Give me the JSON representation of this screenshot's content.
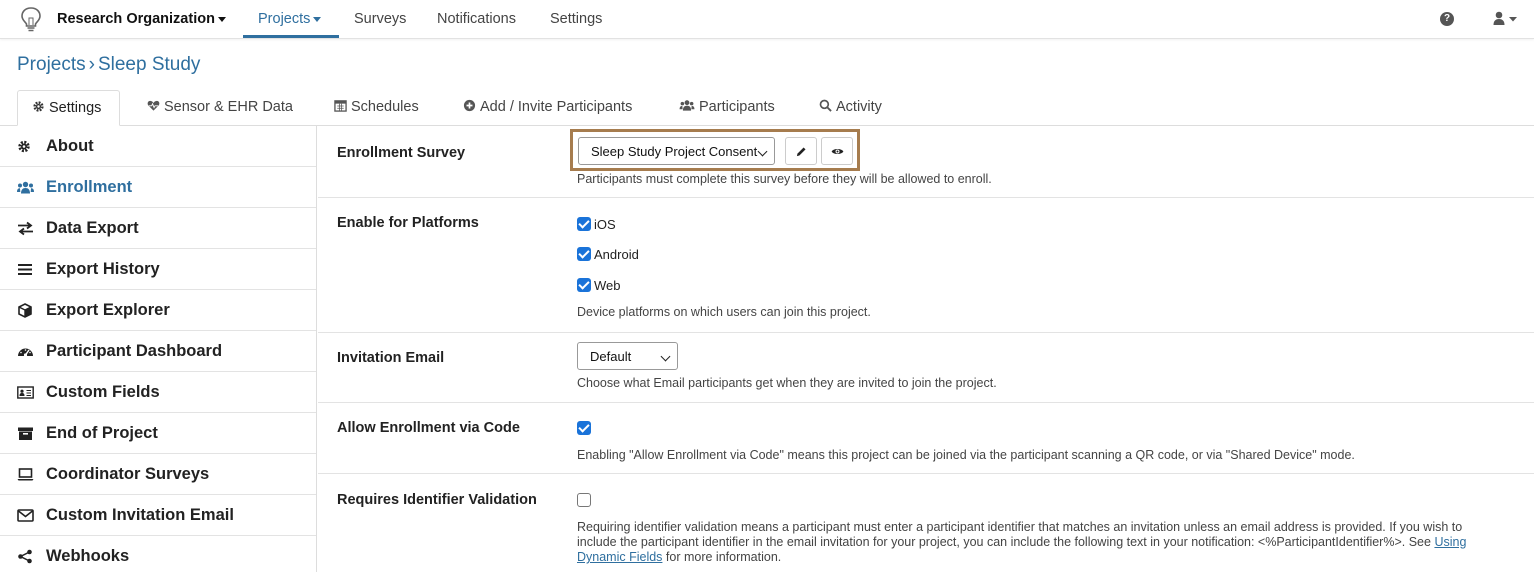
{
  "topnav": {
    "org": "Research Organization",
    "items": [
      "Projects",
      "Surveys",
      "Notifications",
      "Settings"
    ],
    "active": "Projects"
  },
  "breadcrumb": {
    "parent": "Projects",
    "current": "Sleep Study"
  },
  "tabs": [
    {
      "label": "Settings",
      "icon": "gear-icon"
    },
    {
      "label": "Sensor & EHR Data",
      "icon": "heartbeat-icon"
    },
    {
      "label": "Schedules",
      "icon": "calendar-icon"
    },
    {
      "label": "Add / Invite Participants",
      "icon": "plus-circle-icon"
    },
    {
      "label": "Participants",
      "icon": "users-icon"
    },
    {
      "label": "Activity",
      "icon": "search-icon"
    }
  ],
  "sidebar": {
    "items": [
      {
        "label": "About",
        "icon": "gear-icon"
      },
      {
        "label": "Enrollment",
        "icon": "users-icon"
      },
      {
        "label": "Data Export",
        "icon": "exchange-icon"
      },
      {
        "label": "Export History",
        "icon": "list-icon"
      },
      {
        "label": "Export Explorer",
        "icon": "cube-icon"
      },
      {
        "label": "Participant Dashboard",
        "icon": "dashboard-icon"
      },
      {
        "label": "Custom Fields",
        "icon": "id-card-icon"
      },
      {
        "label": "End of Project",
        "icon": "archive-icon"
      },
      {
        "label": "Coordinator Surveys",
        "icon": "laptop-icon"
      },
      {
        "label": "Custom Invitation Email",
        "icon": "envelope-icon"
      },
      {
        "label": "Webhooks",
        "icon": "share-icon"
      }
    ],
    "active": "Enrollment"
  },
  "enrollment_survey": {
    "label": "Enrollment Survey",
    "selected": "Sleep Study Project Consent",
    "help": "Participants must complete this survey before they will be allowed to enroll."
  },
  "platforms": {
    "label": "Enable for Platforms",
    "options": [
      {
        "label": "iOS",
        "checked": true
      },
      {
        "label": "Android",
        "checked": true
      },
      {
        "label": "Web",
        "checked": true
      }
    ],
    "help": "Device platforms on which users can join this project."
  },
  "invitation_email": {
    "label": "Invitation Email",
    "selected": "Default",
    "help": "Choose what Email participants get when they are invited to join the project."
  },
  "enroll_code": {
    "label": "Allow Enrollment via Code",
    "checked": true,
    "help": "Enabling \"Allow Enrollment via Code\" means this project can be joined via the participant scanning a QR code, or via \"Shared Device\" mode."
  },
  "identifier_validation": {
    "label": "Requires Identifier Validation",
    "checked": false,
    "help_line1": "Requiring identifier validation means a participant must enter a participant identifier that matches an invitation unless an email address is provided. If you wish to",
    "help_line2": "include the participant identifier in the email invitation for your project, you can include the following text in your notification: <%ParticipantIdentifier%>. See",
    "link_part1": "Using",
    "link_part2": "Dynamic Fields",
    "help_tail": "for more information."
  },
  "colors": {
    "accent": "#2f6f9f",
    "highlight": "#a67c4e",
    "checkbox": "#1a73d9"
  }
}
